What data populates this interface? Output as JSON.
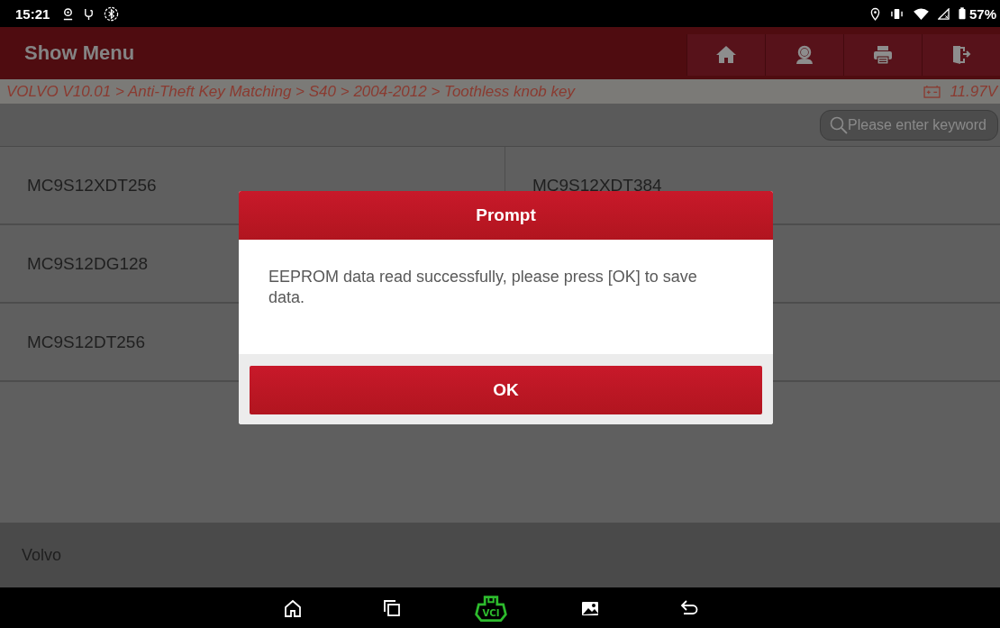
{
  "status_bar": {
    "time": "15:21",
    "battery": "57%"
  },
  "header": {
    "title": "Show Menu",
    "buttons": [
      {
        "kind": "home"
      },
      {
        "kind": "support"
      },
      {
        "kind": "print"
      },
      {
        "kind": "exit"
      }
    ]
  },
  "breadcrumb": {
    "path": "VOLVO V10.01 > Anti-Theft Key Matching > S40 > 2004-2012 > Toothless knob key",
    "voltage": "11.97V"
  },
  "search": {
    "placeholder": "Please enter keyword"
  },
  "menu_rows": [
    {
      "left": "MC9S12XDT256",
      "right": "MC9S12XDT384"
    },
    {
      "left": "MC9S12DG128"
    },
    {
      "left": "MC9S12DT256"
    }
  ],
  "footer": {
    "label": "Volvo"
  },
  "dialog": {
    "title": "Prompt",
    "message": "EEPROM data read successfully, please press [OK] to save data.",
    "button": "OK"
  },
  "nav_bar": {
    "buttons": [
      {
        "kind": "home"
      },
      {
        "kind": "recents"
      },
      {
        "kind": "vci",
        "label": "VCI"
      },
      {
        "kind": "gallery"
      },
      {
        "kind": "back"
      }
    ]
  }
}
